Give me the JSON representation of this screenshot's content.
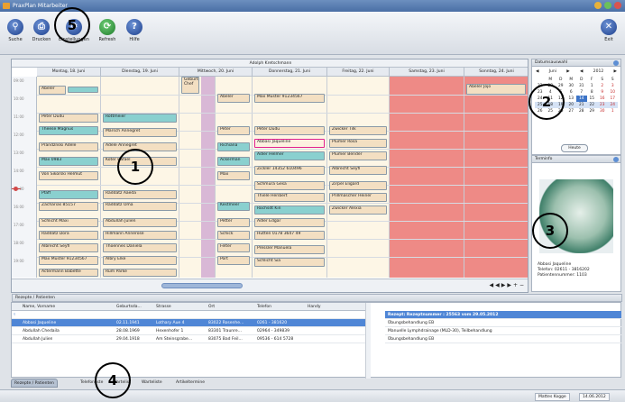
{
  "window": {
    "title": "PraxPlan Mitarbeiter"
  },
  "toolbar": {
    "suche": "Suche",
    "drucken": "Drucken",
    "einstellungen": "Einstellungen",
    "refresh": "Refresh",
    "hilfe": "Hilfe",
    "exit": "Exit"
  },
  "calendar": {
    "title": "Adolph Kretschmann",
    "days": [
      "Montag, 18. Juni",
      "Dienstag, 19. Juni",
      "Mittwoch, 20. Juni",
      "Donnerstag, 21. Juni",
      "Freitag, 22. Juni",
      "Samstag, 23. Juni",
      "Sonntag, 24. Juni"
    ],
    "times": [
      "09:00",
      "10:00",
      "11:00",
      "12:00",
      "13:00",
      "14:00",
      "15:00",
      "16:00",
      "17:00",
      "18:00",
      "19:00"
    ],
    "events": {
      "mon": [
        "Abeler",
        "Peter Dudu",
        "Theese Magnus",
        "Prandznski Adele",
        "Max 0983",
        "Von Sikorski Helmut",
        "Pfaff",
        "Zacharias 85157",
        "Schlicht Maxi",
        "Raddatz Dora",
        "Albrecht Seyfi",
        "Max Muster 91234567",
        "Actermann Babette"
      ],
      "tue": [
        "Rottmeier",
        "Marsch Annegret",
        "Adele Annegret",
        "Köter Rafael",
        "Raddatz Aaeda",
        "Raddatz Oma",
        "Abdullah Julien",
        "Hillmann Annerose",
        "Thoennes Daniela",
        "Albry Elke",
        "Rum Parke"
      ],
      "wed": [
        "Geburtstag Chef",
        "Abeler",
        "Peter",
        "Richiana",
        "Ackerman",
        "Max",
        "Kestmeer",
        "Petter",
        "Schick",
        "Felter",
        "Port"
      ],
      "thu": [
        "Max Muster 91234567",
        "Peter Dudu",
        "Abbasi Jaqueline",
        "Adler Helmer",
        "Zickler 14352 610496",
        "Schmura Gesa",
        "Thiele Heribert",
        "Rochsdt Kin",
        "Adler Edgar",
        "Hütten 0178 3647 49",
        "Pressler Manuela",
        "Schlicht Sia"
      ],
      "fri": [
        "Zwicker Tilk",
        "Plumer Rosa",
        "Plumer Bender",
        "Albrecht Seyfi",
        "Zirpel Eligard",
        "Prillmascher Heiner",
        "Zwicker Alexia"
      ],
      "sun": [
        "Abeler Jojo"
      ]
    }
  },
  "datepicker": {
    "header": "Datumsauswahl",
    "month": "Juni",
    "year": "2012",
    "weekdays": [
      "M",
      "D",
      "M",
      "D",
      "F",
      "S",
      "S"
    ],
    "weeks": [
      {
        "wk": "22",
        "days": [
          "28",
          "29",
          "30",
          "31",
          "1",
          "2",
          "3"
        ]
      },
      {
        "wk": "23",
        "days": [
          "4",
          "5",
          "6",
          "7",
          "8",
          "9",
          "10"
        ]
      },
      {
        "wk": "24",
        "days": [
          "11",
          "12",
          "13",
          "14",
          "15",
          "16",
          "17"
        ]
      },
      {
        "wk": "25",
        "days": [
          "18",
          "19",
          "20",
          "21",
          "22",
          "23",
          "24"
        ]
      },
      {
        "wk": "26",
        "days": [
          "25",
          "26",
          "27",
          "28",
          "29",
          "30",
          "1"
        ]
      }
    ],
    "today_label": "Heute"
  },
  "terminfo": {
    "header": "Terminfo",
    "name": "Abbasi Jaqueline",
    "phone": "Telefon: 02611 - 3816202",
    "patient_nr": "Patientennummer: 1103"
  },
  "patients": {
    "header": "Rezepte / Patienten",
    "columns": [
      "Name, Vorname",
      "Geburtsda...",
      "Strasse",
      "Ort",
      "Telefon",
      "Handy"
    ],
    "rows": [
      [
        "Abbasi Jaqueline",
        "02.11.1941",
        "Lothary Aue 4",
        "83022 Rosenhe...",
        "0261 - 381620",
        ""
      ],
      [
        "Abdullah Chedaila",
        "28.08.1969",
        "Hexenhofer 1",
        "83301 Traunre...",
        "02964 - 349839",
        ""
      ],
      [
        "Abdullah Julien",
        "29.04.1918",
        "Am Steinsgrabe...",
        "83075 Bad Feil...",
        "09536 - 614 5728",
        ""
      ]
    ]
  },
  "rezept": {
    "header": "Rezept: Rezeptnummer : 25563     vom 29.05.2012",
    "items": [
      "Übungsbehandlung EB",
      "Manuelle Lymphdrainage (MLD-30), Teilbehandlung",
      "Übungsbehandlung EB"
    ]
  },
  "tabs": [
    "Rezepte / Patienten",
    "Telefonliste",
    "Wartelist",
    "Warteliste",
    "Artikeltermine"
  ],
  "status": {
    "user": "Mattes Kogge",
    "date": "14.06.2012"
  },
  "callouts": [
    "1",
    "2",
    "3",
    "4",
    "5"
  ]
}
